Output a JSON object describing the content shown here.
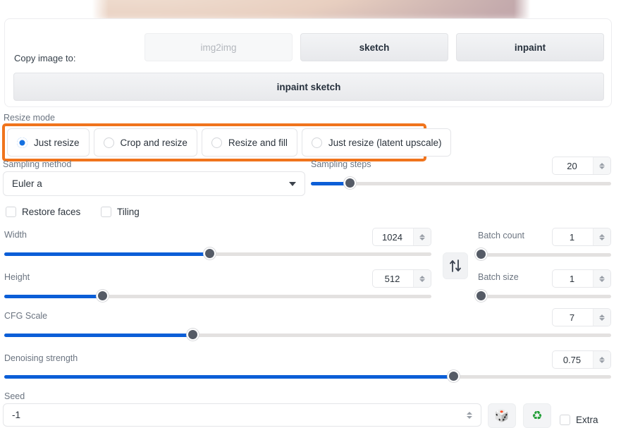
{
  "copy_image": {
    "label": "Copy image to:",
    "buttons": [
      {
        "label": "img2img",
        "state": "disabled"
      },
      {
        "label": "sketch",
        "state": "enabled"
      },
      {
        "label": "inpaint",
        "state": "enabled"
      }
    ],
    "wide_button": {
      "label": "inpaint sketch"
    }
  },
  "resize_mode": {
    "label": "Resize mode",
    "highlight_color": "#f0741d",
    "selected": "Just resize",
    "options": [
      {
        "label": "Just resize",
        "checked": true
      },
      {
        "label": "Crop and resize",
        "checked": false
      },
      {
        "label": "Resize and fill",
        "checked": false
      },
      {
        "label": "Just resize (latent upscale)",
        "checked": false
      }
    ]
  },
  "sampling": {
    "method_label": "Sampling method",
    "method_value": "Euler a",
    "steps_label": "Sampling steps",
    "steps_value": "20",
    "steps_percent": 13
  },
  "toggles": {
    "restore_faces": {
      "label": "Restore faces",
      "checked": false
    },
    "tiling": {
      "label": "Tiling",
      "checked": false
    }
  },
  "dimensions": {
    "width": {
      "label": "Width",
      "value": "1024",
      "percent": 48
    },
    "height": {
      "label": "Height",
      "value": "512",
      "percent": 23
    },
    "swap_icon": "swap-vertical-icon"
  },
  "batch": {
    "count": {
      "label": "Batch count",
      "value": "1",
      "percent": 1
    },
    "size": {
      "label": "Batch size",
      "value": "1",
      "percent": 1
    }
  },
  "cfg": {
    "label": "CFG Scale",
    "value": "7",
    "percent": 31
  },
  "denoising": {
    "label": "Denoising strength",
    "value": "0.75",
    "percent": 74
  },
  "seed": {
    "label": "Seed",
    "value": "-1",
    "random_icon": "dice-icon",
    "recycle_icon": "recycle-icon",
    "extra": {
      "label": "Extra",
      "checked": false
    }
  },
  "accent": {
    "slider_fill": "#0b5ed7",
    "radio_checked": "#1470e0"
  }
}
